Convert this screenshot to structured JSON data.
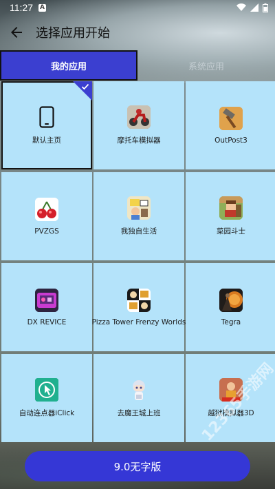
{
  "status_bar": {
    "time": "11:27",
    "notification_badge": "A"
  },
  "app_bar": {
    "title": "选择应用开始"
  },
  "tabs": [
    {
      "label": "我的应用",
      "active": true
    },
    {
      "label": "系统应用",
      "active": false
    }
  ],
  "apps": [
    {
      "label": "默认主页",
      "icon": "phone-icon",
      "selected": true
    },
    {
      "label": "摩托车模拟器",
      "icon": "motorcycle-game-icon"
    },
    {
      "label": "OutPost3",
      "icon": "hammer-icon"
    },
    {
      "label": "PVZGS",
      "icon": "cherry-icon"
    },
    {
      "label": "我独自生活",
      "icon": "life-game-icon"
    },
    {
      "label": "菜园斗士",
      "icon": "pixel-farmer-icon"
    },
    {
      "label": "DX REVICE",
      "icon": "dx-revice-icon"
    },
    {
      "label": "Pizza Tower Frenzy Worlds",
      "icon": "pizza-tower-icon"
    },
    {
      "label": "Tegra",
      "icon": "tegra-icon"
    },
    {
      "label": "自动连点器iClick",
      "icon": "auto-clicker-icon"
    },
    {
      "label": "去魔王城上班",
      "icon": "anime-girl-icon"
    },
    {
      "label": "越狱模拟器3D",
      "icon": "prison-sim-icon"
    }
  ],
  "start_button": {
    "label": "9.0无字版"
  },
  "watermark": "12365手游网",
  "colors": {
    "accent": "#3b3fd0",
    "cell_bg": "#b4e3fa"
  }
}
